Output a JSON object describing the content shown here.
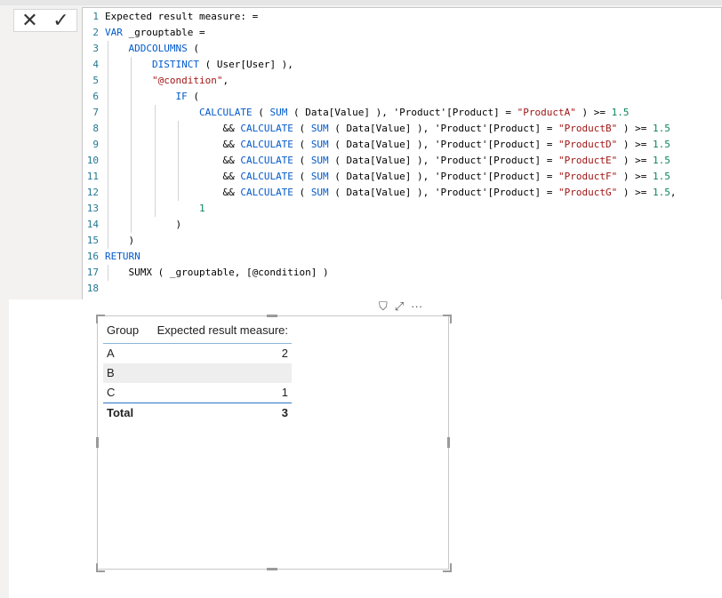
{
  "formula_bar": {
    "cancel_glyph": "✕",
    "commit_glyph": "✓",
    "lines": [
      {
        "n": "1",
        "guides": [],
        "parts": [
          {
            "t": "Expected result measure: =",
            "c": ""
          }
        ]
      },
      {
        "n": "2",
        "guides": [],
        "parts": [
          {
            "t": "VAR",
            "c": "kw"
          },
          {
            "t": " _grouptable =",
            "c": ""
          }
        ]
      },
      {
        "n": "3",
        "guides": [
          1
        ],
        "parts": [
          {
            "t": "    ",
            "c": ""
          },
          {
            "t": "ADDCOLUMNS",
            "c": "kw"
          },
          {
            "t": " (",
            "c": ""
          }
        ]
      },
      {
        "n": "4",
        "guides": [
          1,
          2
        ],
        "parts": [
          {
            "t": "        ",
            "c": ""
          },
          {
            "t": "DISTINCT",
            "c": "kw"
          },
          {
            "t": " ( User[User] ),",
            "c": ""
          }
        ]
      },
      {
        "n": "5",
        "guides": [
          1,
          2
        ],
        "parts": [
          {
            "t": "        ",
            "c": ""
          },
          {
            "t": "\"@condition\"",
            "c": "str"
          },
          {
            "t": ",",
            "c": ""
          }
        ]
      },
      {
        "n": "6",
        "guides": [
          1,
          2
        ],
        "parts": [
          {
            "t": "            ",
            "c": ""
          },
          {
            "t": "IF",
            "c": "kw"
          },
          {
            "t": " (",
            "c": ""
          }
        ]
      },
      {
        "n": "7",
        "guides": [
          1,
          2,
          3
        ],
        "parts": [
          {
            "t": "                ",
            "c": ""
          },
          {
            "t": "CALCULATE",
            "c": "kw"
          },
          {
            "t": " ( ",
            "c": ""
          },
          {
            "t": "SUM",
            "c": "kw"
          },
          {
            "t": " ( Data[Value] ), 'Product'[Product] = ",
            "c": ""
          },
          {
            "t": "\"ProductA\"",
            "c": "str"
          },
          {
            "t": " ) >= ",
            "c": ""
          },
          {
            "t": "1.5",
            "c": "num"
          }
        ]
      },
      {
        "n": "8",
        "guides": [
          1,
          2,
          3,
          4
        ],
        "parts": [
          {
            "t": "                    && ",
            "c": ""
          },
          {
            "t": "CALCULATE",
            "c": "kw"
          },
          {
            "t": " ( ",
            "c": ""
          },
          {
            "t": "SUM",
            "c": "kw"
          },
          {
            "t": " ( Data[Value] ), 'Product'[Product] = ",
            "c": ""
          },
          {
            "t": "\"ProductB\"",
            "c": "str"
          },
          {
            "t": " ) >= ",
            "c": ""
          },
          {
            "t": "1.5",
            "c": "num"
          }
        ]
      },
      {
        "n": "9",
        "guides": [
          1,
          2,
          3,
          4
        ],
        "parts": [
          {
            "t": "                    && ",
            "c": ""
          },
          {
            "t": "CALCULATE",
            "c": "kw"
          },
          {
            "t": " ( ",
            "c": ""
          },
          {
            "t": "SUM",
            "c": "kw"
          },
          {
            "t": " ( Data[Value] ), 'Product'[Product] = ",
            "c": ""
          },
          {
            "t": "\"ProductD\"",
            "c": "str"
          },
          {
            "t": " ) >= ",
            "c": ""
          },
          {
            "t": "1.5",
            "c": "num"
          }
        ]
      },
      {
        "n": "10",
        "guides": [
          1,
          2,
          3,
          4
        ],
        "parts": [
          {
            "t": "                    && ",
            "c": ""
          },
          {
            "t": "CALCULATE",
            "c": "kw"
          },
          {
            "t": " ( ",
            "c": ""
          },
          {
            "t": "SUM",
            "c": "kw"
          },
          {
            "t": " ( Data[Value] ), 'Product'[Product] = ",
            "c": ""
          },
          {
            "t": "\"ProductE\"",
            "c": "str"
          },
          {
            "t": " ) >= ",
            "c": ""
          },
          {
            "t": "1.5",
            "c": "num"
          }
        ]
      },
      {
        "n": "11",
        "guides": [
          1,
          2,
          3,
          4
        ],
        "parts": [
          {
            "t": "                    && ",
            "c": ""
          },
          {
            "t": "CALCULATE",
            "c": "kw"
          },
          {
            "t": " ( ",
            "c": ""
          },
          {
            "t": "SUM",
            "c": "kw"
          },
          {
            "t": " ( Data[Value] ), 'Product'[Product] = ",
            "c": ""
          },
          {
            "t": "\"ProductF\"",
            "c": "str"
          },
          {
            "t": " ) >= ",
            "c": ""
          },
          {
            "t": "1.5",
            "c": "num"
          }
        ]
      },
      {
        "n": "12",
        "guides": [
          1,
          2,
          3,
          4
        ],
        "parts": [
          {
            "t": "                    && ",
            "c": ""
          },
          {
            "t": "CALCULATE",
            "c": "kw"
          },
          {
            "t": " ( ",
            "c": ""
          },
          {
            "t": "SUM",
            "c": "kw"
          },
          {
            "t": " ( Data[Value] ), 'Product'[Product] = ",
            "c": ""
          },
          {
            "t": "\"ProductG\"",
            "c": "str"
          },
          {
            "t": " ) >= ",
            "c": ""
          },
          {
            "t": "1.5",
            "c": "num"
          },
          {
            "t": ",",
            "c": ""
          }
        ]
      },
      {
        "n": "13",
        "guides": [
          1,
          2,
          3
        ],
        "parts": [
          {
            "t": "                ",
            "c": ""
          },
          {
            "t": "1",
            "c": "num"
          }
        ]
      },
      {
        "n": "14",
        "guides": [
          1,
          2
        ],
        "parts": [
          {
            "t": "            )",
            "c": ""
          }
        ]
      },
      {
        "n": "15",
        "guides": [
          1
        ],
        "parts": [
          {
            "t": "    )",
            "c": ""
          }
        ]
      },
      {
        "n": "16",
        "guides": [],
        "parts": [
          {
            "t": "RETURN",
            "c": "kw"
          }
        ]
      },
      {
        "n": "17",
        "guides": [
          1
        ],
        "parts": [
          {
            "t": "    SUMX ( _grouptable, [@condition] )",
            "c": ""
          }
        ]
      },
      {
        "n": "18",
        "guides": [],
        "parts": []
      }
    ]
  },
  "visual_header": {
    "filter_icon": "filter-icon",
    "focus_icon": "focus-mode-icon",
    "more_icon": "more-options-icon",
    "filter_glyph": "⛉",
    "focus_glyph": "⤢",
    "more_glyph": "···"
  },
  "matrix": {
    "headers": [
      "Group",
      "Expected result measure:"
    ],
    "rows": [
      {
        "group": "A",
        "value": "2"
      },
      {
        "group": "B",
        "value": ""
      },
      {
        "group": "C",
        "value": "1"
      }
    ],
    "total": {
      "label": "Total",
      "value": "3"
    }
  }
}
